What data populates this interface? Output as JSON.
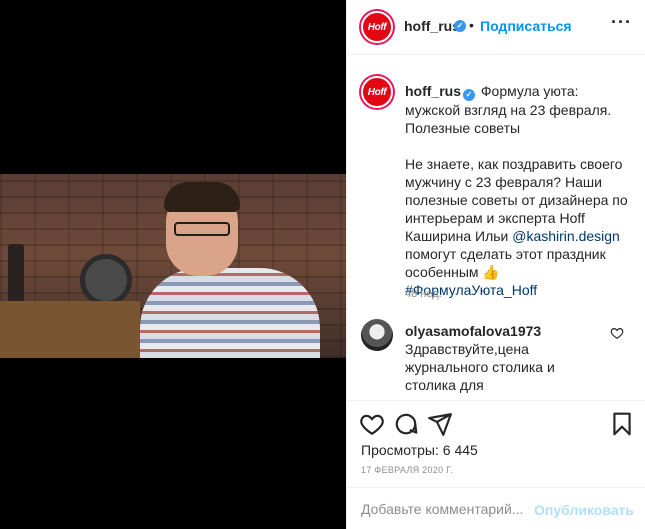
{
  "post": {
    "username": "hoff_rus",
    "avatar_text": "Hoff",
    "follow_label": "Подписаться",
    "dot": "•",
    "more_icon": "more-options-icon",
    "more_glyph": "···",
    "verified_glyph": "✓"
  },
  "caption": {
    "username": "hoff_rus",
    "title": "Формула уюта: мужской взгляд на 23 февраля. Полезные советы",
    "body_1": "Не знаете, как поздравить своего мужчину с 23 февраля? Наши полезные советы от дизайнера по интерьерам и эксперта Hoff Каширина Ильи ",
    "mention": "@kashirin.design",
    "body_2": " помогут сделать этот праздник особенным ",
    "emoji": "👍",
    "hashtag": "#ФормулаУюта_Hoff",
    "time": "48 нед."
  },
  "comment": {
    "username": "olyasamofalova1973",
    "text": "Здравствуйте,цена журнального столика и столика для сервировки,картины на стене и необычные тарелки для закусок"
  },
  "actions": {
    "icons": [
      "heart-icon",
      "comment-icon",
      "share-icon",
      "save-bookmark-icon"
    ],
    "views_label": "Просмотры:",
    "views_count": "6 445",
    "date": "17 ФЕВРАЛЯ 2020 Г."
  },
  "add_comment": {
    "placeholder": "Добавьте комментарий...",
    "publish_label": "Опубликовать"
  },
  "colors": {
    "accent": "#0095f6",
    "brand_red": "#e30613",
    "verified": "#3897f0",
    "publish_disabled": "#b2dffc"
  }
}
